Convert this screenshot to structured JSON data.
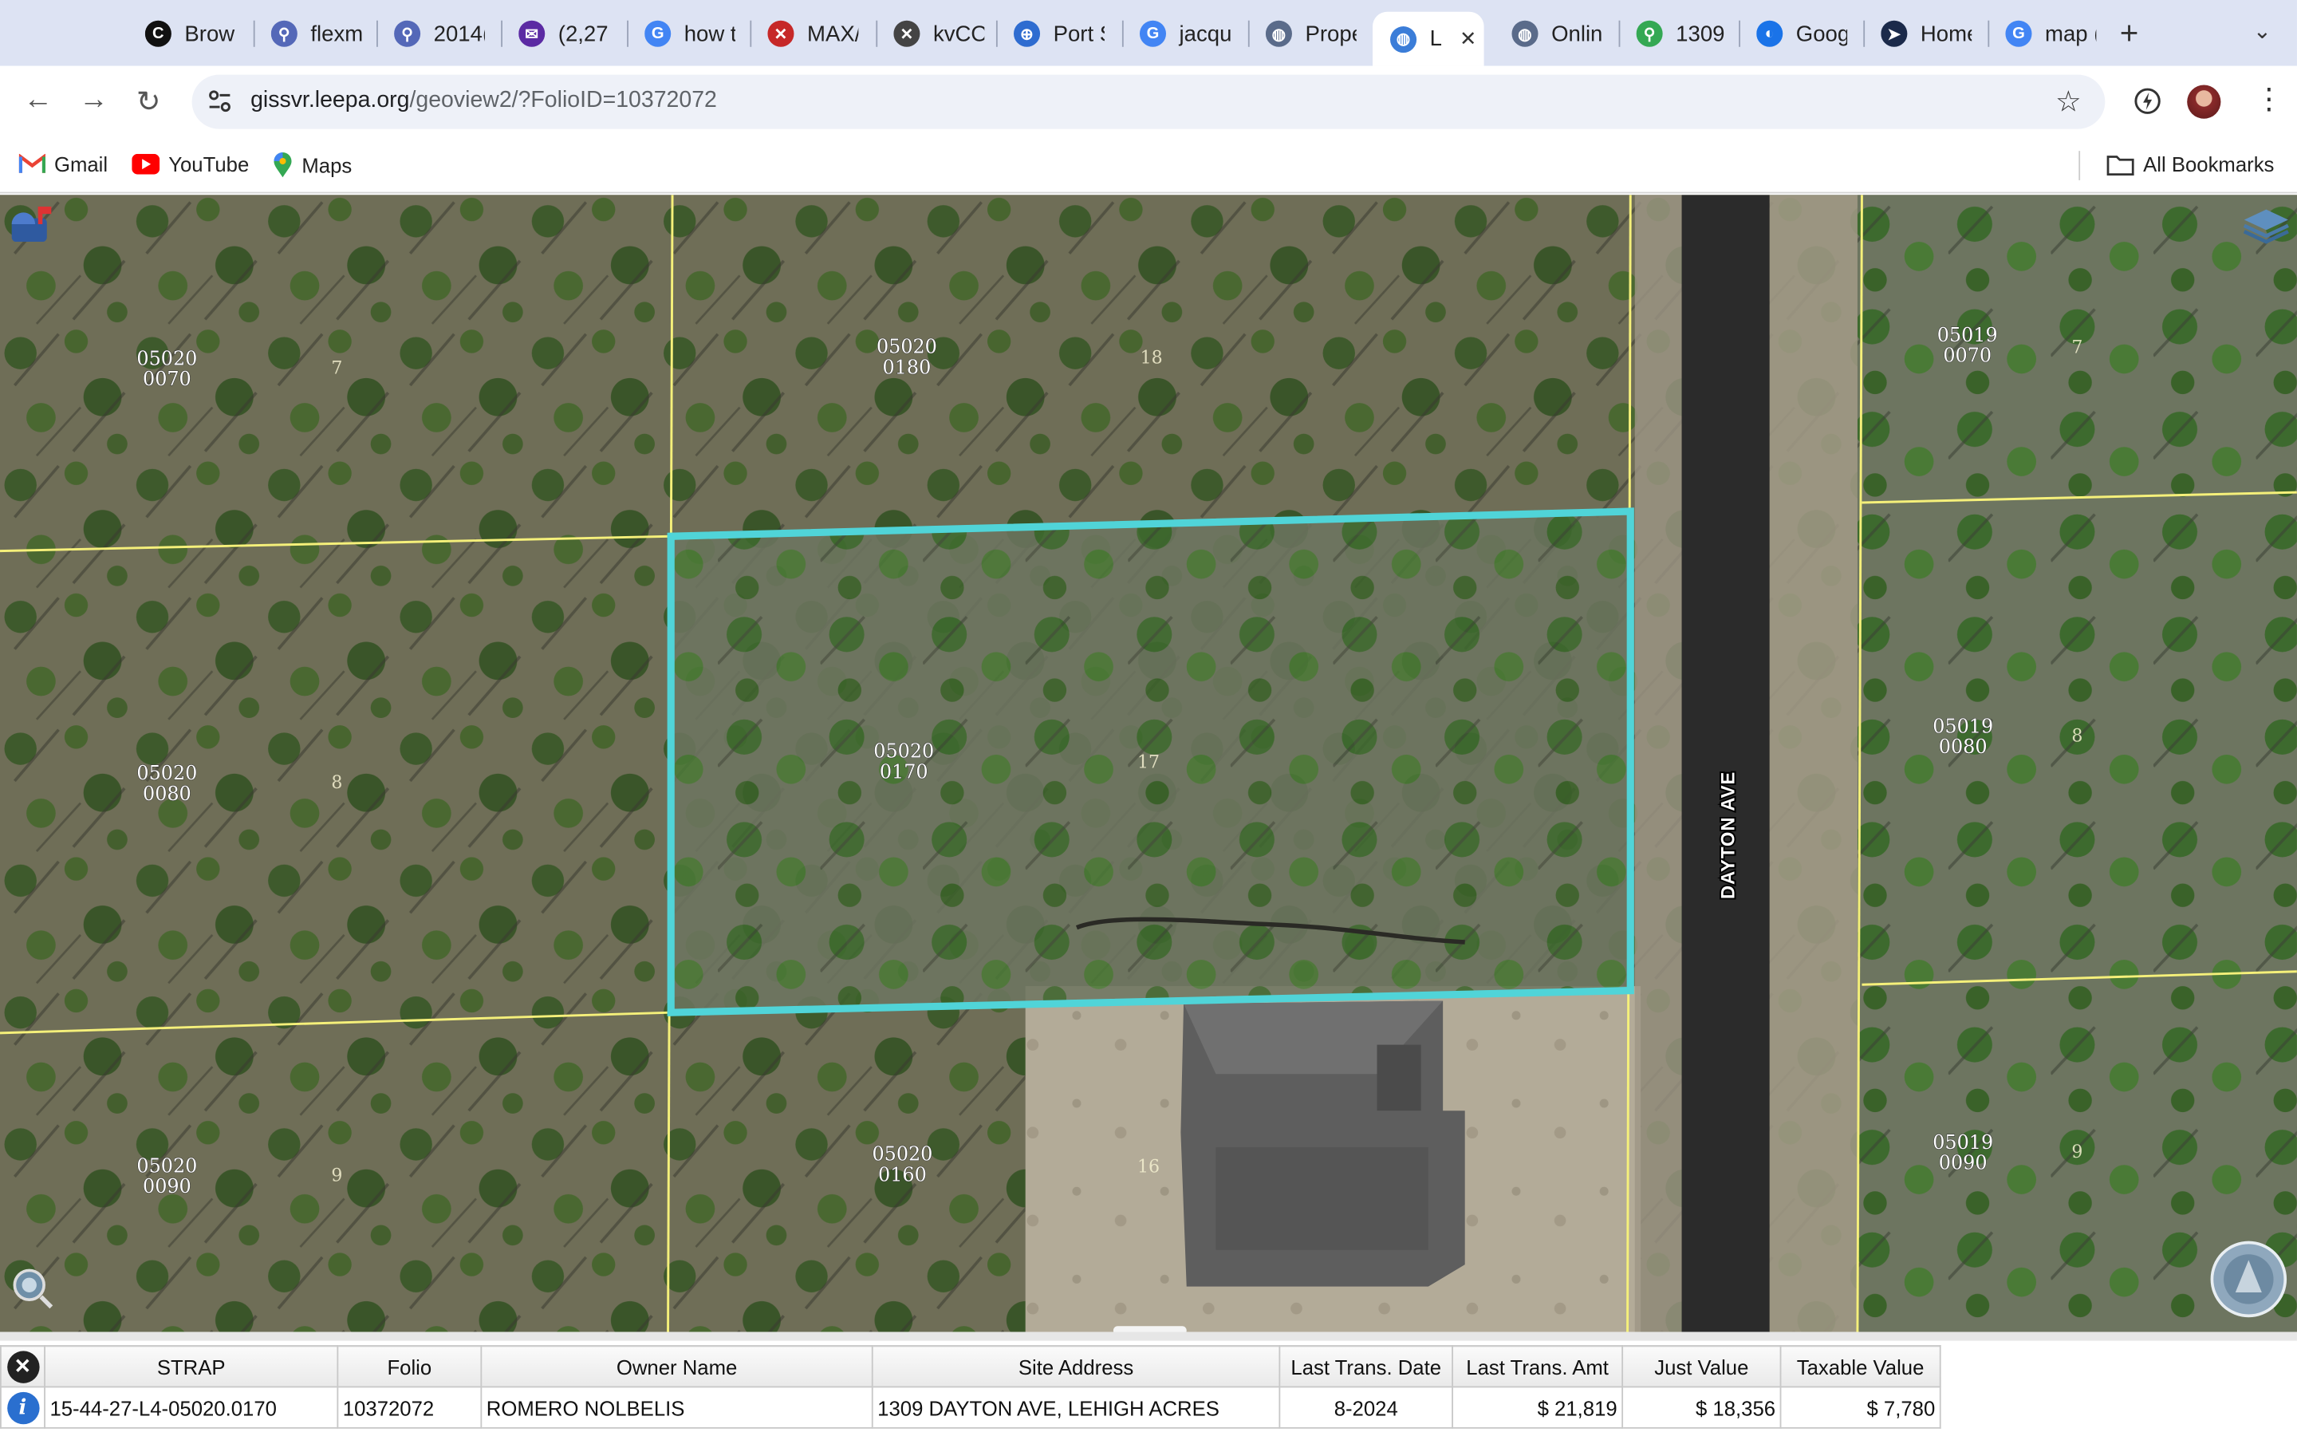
{
  "tabs": [
    {
      "label": "Brow",
      "icon": "c-app-icon",
      "fav_bg": "#111",
      "fav_txt": "C"
    },
    {
      "label": "flexm",
      "icon": "location-icon",
      "fav_bg": "#5468b8",
      "fav_txt": "⚲"
    },
    {
      "label": "2014(",
      "icon": "location-icon",
      "fav_bg": "#5468b8",
      "fav_txt": "⚲"
    },
    {
      "label": "(2,27",
      "icon": "mail-icon",
      "fav_bg": "#5b2aa3",
      "fav_txt": "✉"
    },
    {
      "label": "how t",
      "icon": "google-icon",
      "fav_bg": "#4285f4",
      "fav_txt": "G"
    },
    {
      "label": "MAX/",
      "icon": "x-red-icon",
      "fav_bg": "#c62828",
      "fav_txt": "✕"
    },
    {
      "label": "kvCO",
      "icon": "x-icon",
      "fav_bg": "#444",
      "fav_txt": "✕"
    },
    {
      "label": "Port S",
      "icon": "port-icon",
      "fav_bg": "#2e6cd0",
      "fav_txt": "⊕"
    },
    {
      "label": "jacqu",
      "icon": "google-icon",
      "fav_bg": "#4285f4",
      "fav_txt": "G"
    },
    {
      "label": "Prope",
      "icon": "globe-icon",
      "fav_bg": "#5a6b8a",
      "fav_txt": "◍"
    },
    {
      "label": "L",
      "icon": "globe-icon",
      "fav_bg": "#3b7dd8",
      "fav_txt": "◍",
      "active": true
    },
    {
      "label": "Onlin",
      "icon": "globe-icon",
      "fav_bg": "#5a6b8a",
      "fav_txt": "◍"
    },
    {
      "label": "1309",
      "icon": "maps-pin-icon",
      "fav_bg": "#34a853",
      "fav_txt": "⚲"
    },
    {
      "label": "Goog",
      "icon": "earth-icon",
      "fav_bg": "#1a73e8",
      "fav_txt": "◐"
    },
    {
      "label": "Home",
      "icon": "arrow-logo-icon",
      "fav_bg": "#1b2a4a",
      "fav_txt": "➤"
    },
    {
      "label": "map (",
      "icon": "google-icon",
      "fav_bg": "#4285f4",
      "fav_txt": "G"
    }
  ],
  "address_bar": {
    "domain": "gissvr.leepa.org",
    "path": "/geoview2/?FolioID=10372072"
  },
  "bookmarks": [
    {
      "label": "Gmail",
      "icon": "gmail-icon"
    },
    {
      "label": "YouTube",
      "icon": "youtube-icon"
    },
    {
      "label": "Maps",
      "icon": "maps-icon"
    }
  ],
  "all_bookmarks": "All Bookmarks",
  "map": {
    "street_label": "DAYTON AVE",
    "parcels": [
      {
        "line1": "05020",
        "line2": "0070"
      },
      {
        "line1": "05020",
        "line2": "0180"
      },
      {
        "line1": "05019",
        "line2": "0070"
      },
      {
        "line1": "05020",
        "line2": "0080"
      },
      {
        "line1": "05020",
        "line2": "0170"
      },
      {
        "line1": "05019",
        "line2": "0080"
      },
      {
        "line1": "05020",
        "line2": "0090"
      },
      {
        "line1": "05020",
        "line2": "0160"
      },
      {
        "line1": "05019",
        "line2": "0090"
      }
    ],
    "lot_numbers": [
      "7",
      "18",
      "7",
      "8",
      "17",
      "8",
      "9",
      "16",
      "9"
    ]
  },
  "grid": {
    "headers": [
      "STRAP",
      "Folio",
      "Owner Name",
      "Site Address",
      "Last Trans. Date",
      "Last Trans. Amt",
      "Just Value",
      "Taxable Value"
    ],
    "row": {
      "strap": "15-44-27-L4-05020.0170",
      "folio": "10372072",
      "owner": "ROMERO NOLBELIS",
      "address": "1309 DAYTON AVE, LEHIGH ACRES",
      "date": "8-2024",
      "amt": "$ 21,819",
      "just": "$ 18,356",
      "taxable": "$ 7,780"
    }
  }
}
